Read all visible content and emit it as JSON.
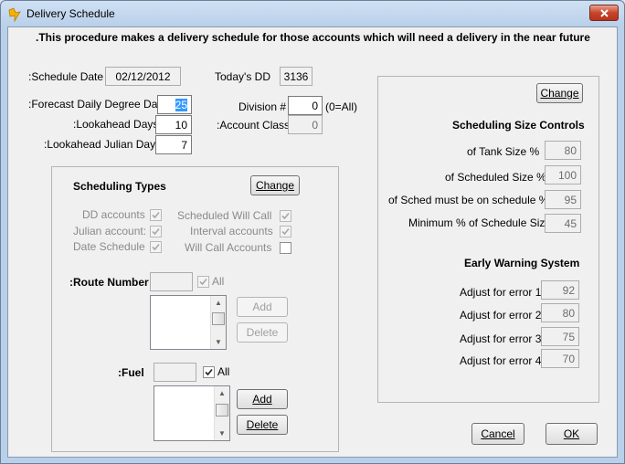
{
  "window": {
    "title": "Delivery Schedule",
    "app_icon": "lightning-icon",
    "close_icon": "close-icon"
  },
  "intro": "This procedure makes a delivery schedule for those accounts which will need a delivery in the near future.",
  "left": {
    "schedule_date_label": ":Schedule Date",
    "schedule_date_value": "02/12/2012",
    "todays_dd_label": "Today's DD",
    "todays_dd_value": "3136",
    "forecast_label": ":Forecast Daily Degree Days",
    "forecast_value": "25",
    "lookahead_label": ":Lookahead Days",
    "lookahead_value": "10",
    "lookahead_julian_label": ":Lookahead Julian  Days",
    "lookahead_julian_value": "7",
    "division_label": "Division #",
    "division_value": "0",
    "division_hint": "(0=All)",
    "account_class_label": ":Account Class",
    "account_class_value": "0"
  },
  "types": {
    "title": "Scheduling Types",
    "change_label": "Change",
    "dd_accounts": "DD accounts",
    "julian_accounts": "Julian account:",
    "date_schedule": "Date Schedule",
    "scheduled_will_call": "Scheduled Will Call",
    "interval_accounts": "Interval accounts",
    "will_call_accounts": "Will Call Accounts",
    "route_label": ":Route Number",
    "route_value": "",
    "route_all": "All",
    "fuel_label": ":Fuel",
    "fuel_value": "",
    "fuel_all": "All",
    "add_label": "Add",
    "delete_label": "Delete"
  },
  "right": {
    "change_label": "Change",
    "size_title": "Scheduling Size Controls",
    "tank_size_label": "of Tank Size %",
    "tank_size_value": "80",
    "sched_size_label": "of Scheduled Size %",
    "sched_size_value": "100",
    "on_schedule_label": "of Sched must be on schedule %",
    "on_schedule_value": "95",
    "min_label": "Minimum % of Schedule Size",
    "min_value": "45",
    "ews_title": "Early Warning System",
    "error1_label": "Adjust for error 1",
    "error1_value": "92",
    "error2_label": "Adjust for error 2",
    "error2_value": "80",
    "error3_label": "Adjust for error 3",
    "error3_value": "75",
    "error4_label": "Adjust for error 4",
    "error4_value": "70"
  },
  "footer": {
    "cancel_label": "Cancel",
    "ok_label": "OK"
  },
  "colors": {
    "selection": "#3399ff",
    "titlebar": "#b9d0ea",
    "close": "#c7452c"
  }
}
